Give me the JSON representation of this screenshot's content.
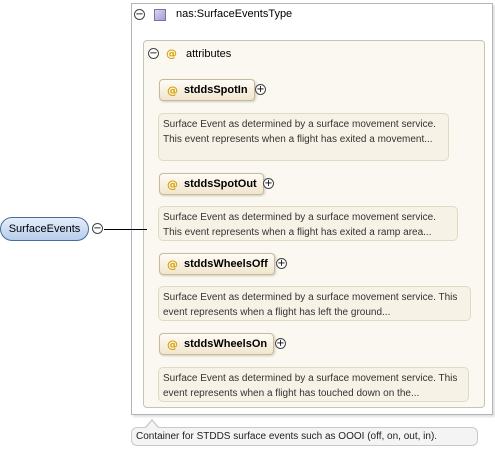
{
  "element": {
    "name": "SurfaceEvents"
  },
  "type": {
    "name": "nas:SurfaceEventsType"
  },
  "attributes_group": {
    "label": "attributes",
    "at_symbol": "@"
  },
  "attributes": [
    {
      "name": "stddsSpotIn",
      "doc": "Surface Event as determined by a surface movement service. This event represents when a flight has exited a movement..."
    },
    {
      "name": "stddsSpotOut",
      "doc": "Surface Event as determined by a surface movement service. This event represents when a flight has exited a ramp area..."
    },
    {
      "name": "stddsWheelsOff",
      "doc": "Surface Event as determined by a surface movement service. This event represents when a flight has left the ground..."
    },
    {
      "name": "stddsWheelsOn",
      "doc": "Surface Event as determined by a surface movement service. This event represents when a flight has touched down on the..."
    }
  ],
  "bottom_doc": "Container for STDDS surface events such as OOOI (off, on, out, in).",
  "icons": {
    "collapse": "⊖",
    "expand": "⊕"
  }
}
